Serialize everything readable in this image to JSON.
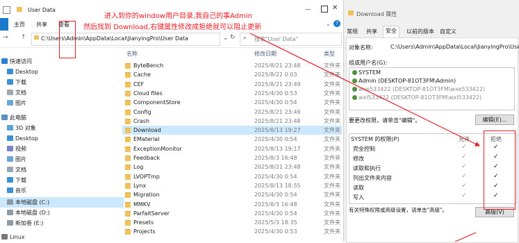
{
  "explorer": {
    "title": "User Data",
    "ribbon_tabs": [
      "文件",
      "主页",
      "共享",
      "查看"
    ],
    "address": "C:\\Users\\Admin\\AppData\\Local\\JianyingPro\\User Data",
    "search_placeholder": "搜索\"User Data\"",
    "columns": {
      "name": "名称",
      "date": "修改日期",
      "type": "类型"
    },
    "nav": [
      {
        "label": "快速访问",
        "icon": "star-icon"
      },
      {
        "label": "Desktop",
        "icon": "desktop-icon"
      },
      {
        "label": "下载",
        "icon": "download-icon"
      },
      {
        "label": "文档",
        "icon": "document-icon"
      },
      {
        "label": "图片",
        "icon": "picture-icon"
      },
      {
        "label": "此电脑",
        "icon": "computer-icon"
      },
      {
        "label": "3D 对象",
        "icon": "cube-icon"
      },
      {
        "label": "Desktop",
        "icon": "desktop-icon"
      },
      {
        "label": "视频",
        "icon": "video-icon"
      },
      {
        "label": "图片",
        "icon": "picture-icon"
      },
      {
        "label": "文档",
        "icon": "document-icon"
      },
      {
        "label": "下载",
        "icon": "download-icon"
      },
      {
        "label": "音乐",
        "icon": "music-icon"
      },
      {
        "label": "本地磁盘 (C:)",
        "icon": "drive-icon"
      },
      {
        "label": "本地磁盘 (D:)",
        "icon": "drive-icon"
      },
      {
        "label": "新加卷 (E:)",
        "icon": "drive-icon"
      },
      {
        "label": "Linux",
        "icon": "linux-icon"
      }
    ],
    "files": [
      {
        "name": "ByteBench",
        "date": "2025/8/21 23:48",
        "type": "文件夹"
      },
      {
        "name": "Cache",
        "date": "2025/8/22 0:03",
        "type": "文件夹"
      },
      {
        "name": "CEF",
        "date": "2025/8/21 23:49",
        "type": "文件夹"
      },
      {
        "name": "Cloud files",
        "date": "2025/4/30 0:53",
        "type": "文件夹"
      },
      {
        "name": "ComponentStore",
        "date": "2025/4/30 0:54",
        "type": "文件夹"
      },
      {
        "name": "Config",
        "date": "2025/8/21 23:49",
        "type": "文件夹"
      },
      {
        "name": "Crash",
        "date": "2025/8/21 23:48",
        "type": "文件夹"
      },
      {
        "name": "Download",
        "date": "2025/8/13 19:27",
        "type": "文件夹"
      },
      {
        "name": "EMaterial",
        "date": "2025/4/30 0:54",
        "type": "文件夹"
      },
      {
        "name": "ExceptionMonitor",
        "date": "2025/8/13 19:17",
        "type": "文件夹"
      },
      {
        "name": "Feedback",
        "date": "2025/8/3 16:48",
        "type": "文件夹"
      },
      {
        "name": "Log",
        "date": "2025/8/21 23:48",
        "type": "文件夹"
      },
      {
        "name": "LVOPTmp",
        "date": "2025/4/30 0:54",
        "type": "文件夹"
      },
      {
        "name": "Lynx",
        "date": "2025/8/13 18:55",
        "type": "文件夹"
      },
      {
        "name": "Migration",
        "date": "2025/4/30 0:54",
        "type": "文件夹"
      },
      {
        "name": "MMKV",
        "date": "2025/8/3 16:48",
        "type": "文件夹"
      },
      {
        "name": "ParfaitServer",
        "date": "2025/4/30 0:54",
        "type": "文件夹"
      },
      {
        "name": "Presets",
        "date": "2025/5/3 18:35",
        "type": "文件夹"
      },
      {
        "name": "Projects",
        "date": "2025/4/30 0:53",
        "type": "文件夹"
      }
    ]
  },
  "props": {
    "title": "Download 属性",
    "tabs": [
      "常规",
      "共享",
      "安全",
      "以前的版本",
      "自定义"
    ],
    "object_label": "对象名称:",
    "object_value": "C:\\Users\\Admin\\AppData\\Local\\JianyingPro\\User Data",
    "group_label": "组或用户名(G):",
    "users": [
      {
        "label": "SYSTEM",
        "blur": false
      },
      {
        "label": "Admin (DESKTOP-81OT3FM\\Admin)",
        "blur": false
      },
      {
        "label": "wxe533422 (DESKTOP-81OT3FM\\wxe533422)",
        "blur": true
      },
      {
        "label": "wxl533422 (DESKTOP-81OT3FM\\wxl533422)",
        "blur": true
      }
    ],
    "change_hint": "要更改权限，请单击\"编辑\"。",
    "edit_button": "编辑(E)...",
    "perm_title": "SYSTEM 的权限(P)",
    "allow_label": "允许",
    "deny_label": "拒绝",
    "permissions": [
      "完全控制",
      "修改",
      "读取和执行",
      "列出文件夹内容",
      "读取",
      "写入"
    ],
    "advanced_hint": "有关特殊权限或高级设置，请单击\"高级\"。",
    "advanced_button": "高级(V)"
  },
  "annotation": {
    "line1": "进入到你的window用户目录,我自己的事Admin",
    "line2": "然后找到 Download,右键属性修改成拒绝就可以阻止更新"
  },
  "colors": {
    "accent": "#1979ca",
    "annotation": "#e81c24",
    "selection": "#cce8ff"
  }
}
